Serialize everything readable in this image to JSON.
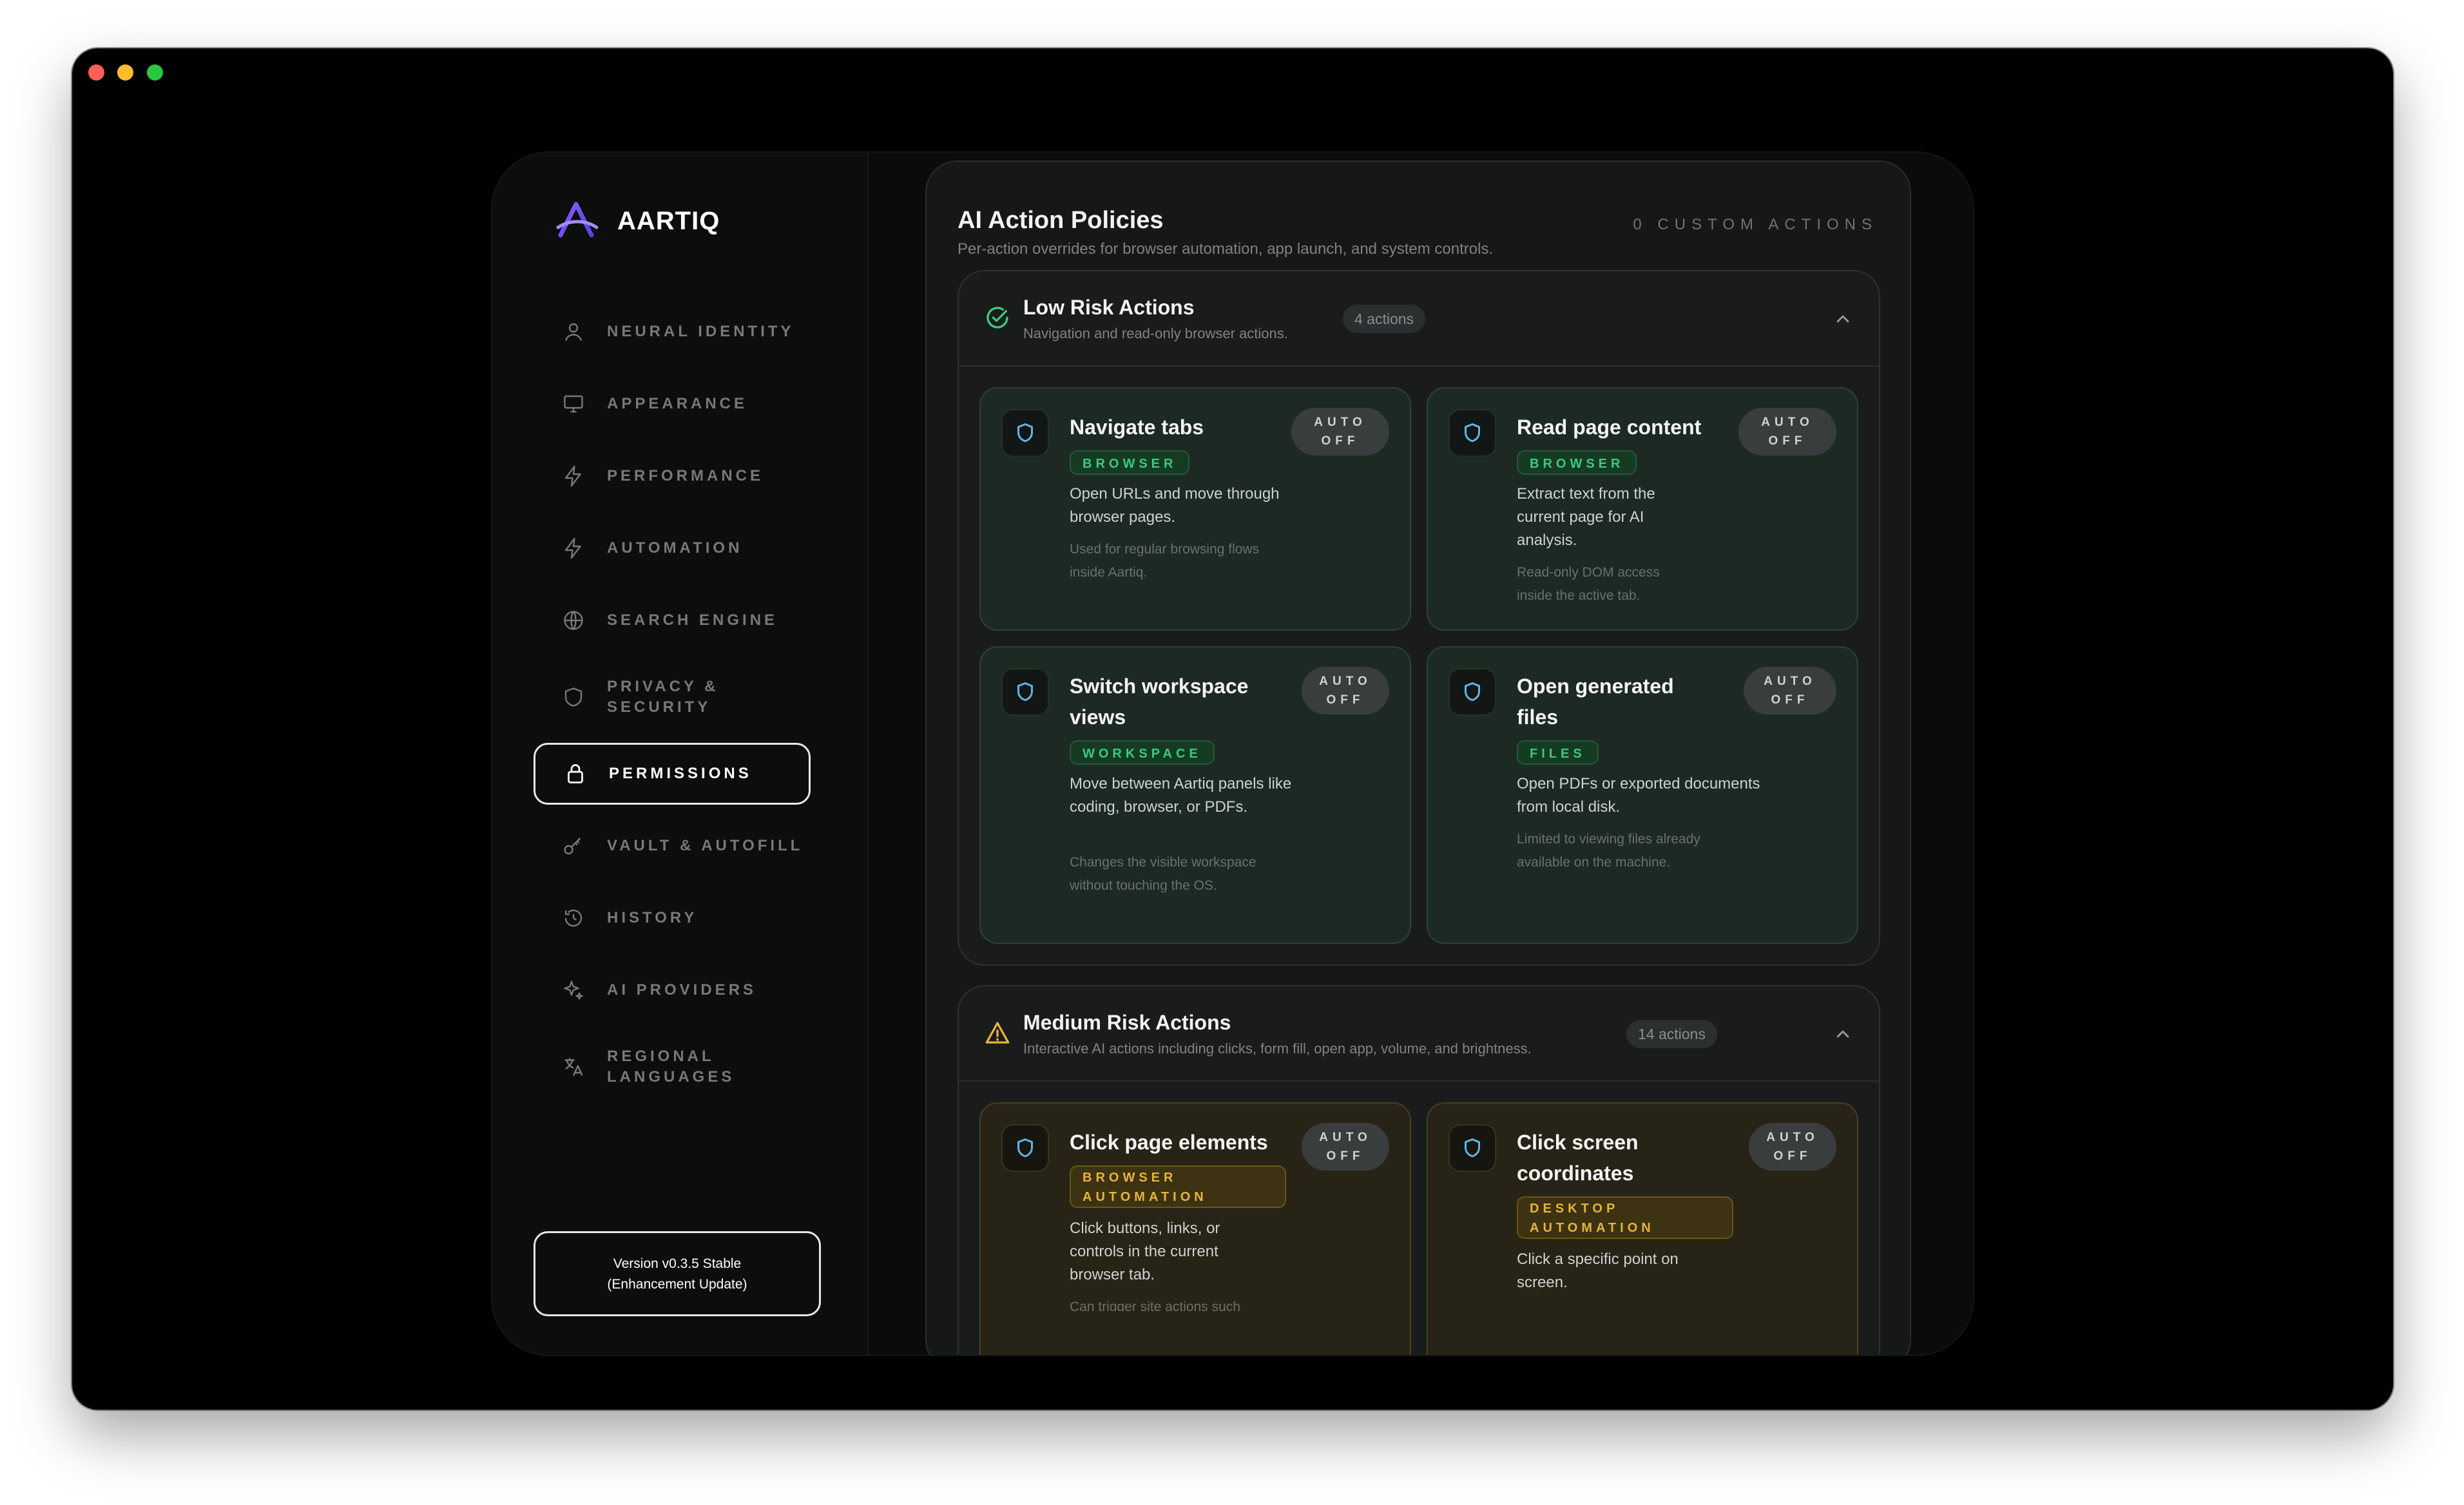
{
  "app": {
    "brand": "AARTIQ",
    "version_line1": "Version v0.3.5 Stable",
    "version_line2": "(Enhancement Update)"
  },
  "sidebar": {
    "items": [
      {
        "label": "NEURAL IDENTITY",
        "icon": "user-icon"
      },
      {
        "label": "APPEARANCE",
        "icon": "monitor-icon"
      },
      {
        "label": "PERFORMANCE",
        "icon": "bolt-icon"
      },
      {
        "label": "AUTOMATION",
        "icon": "bolt-icon"
      },
      {
        "label": "SEARCH ENGINE",
        "icon": "globe-icon"
      },
      {
        "label": "PRIVACY &\nSECURITY",
        "icon": "shield-icon"
      },
      {
        "label": "PERMISSIONS",
        "icon": "lock-icon",
        "active": true
      },
      {
        "label": "VAULT & AUTOFILL",
        "icon": "key-icon"
      },
      {
        "label": "HISTORY",
        "icon": "history-icon"
      },
      {
        "label": "AI PROVIDERS",
        "icon": "sparkles-icon"
      },
      {
        "label": "REGIONAL\nLANGUAGES",
        "icon": "translate-icon"
      }
    ]
  },
  "panel": {
    "title": "AI Action Policies",
    "subtitle": "Per-action overrides for browser automation, app launch, and system controls.",
    "custom_count": "0 CUSTOM ACTIONS"
  },
  "groups": {
    "low": {
      "title": "Low Risk Actions",
      "subtitle": "Navigation and read-only browser actions.",
      "count": "4 actions",
      "cards": [
        {
          "title": "Navigate tabs",
          "toggle": "AUTO OFF",
          "tag": "BROWSER",
          "desc": "Open URLs and move through browser pages.",
          "note": "Used for regular browsing flows inside Aartiq."
        },
        {
          "title": "Read page content",
          "toggle": "AUTO OFF",
          "tag": "BROWSER",
          "desc": "Extract text from the current page for AI analysis.",
          "note": "Read-only DOM access inside the active tab."
        },
        {
          "title": "Switch workspace views",
          "toggle": "AUTO OFF",
          "tag": "WORKSPACE",
          "desc": "Move between Aartiq panels like coding, browser, or PDFs.",
          "note": "Changes the visible workspace without touching the OS."
        },
        {
          "title": "Open generated files",
          "toggle": "AUTO OFF",
          "tag": "FILES",
          "desc": "Open PDFs or exported documents from local disk.",
          "note": "Limited to viewing files already available on the machine."
        }
      ]
    },
    "medium": {
      "title": "Medium Risk Actions",
      "subtitle": "Interactive AI actions including clicks, form fill, open app, volume, and brightness.",
      "count": "14 actions",
      "cards": [
        {
          "title": "Click page elements",
          "toggle": "AUTO OFF",
          "tag": "BROWSER AUTOMATION",
          "desc": "Click buttons, links, or controls in the current browser tab.",
          "note": "Can trigger site actions such"
        },
        {
          "title": "Click screen coordinates",
          "toggle": "AUTO OFF",
          "tag": "DESKTOP AUTOMATION",
          "desc": "Click a specific point on screen.",
          "note": ""
        }
      ]
    }
  },
  "colors": {
    "low_accent": "#3ec97a",
    "medium_accent": "#e5b53a",
    "shield_accent": "#5fb6e8"
  }
}
